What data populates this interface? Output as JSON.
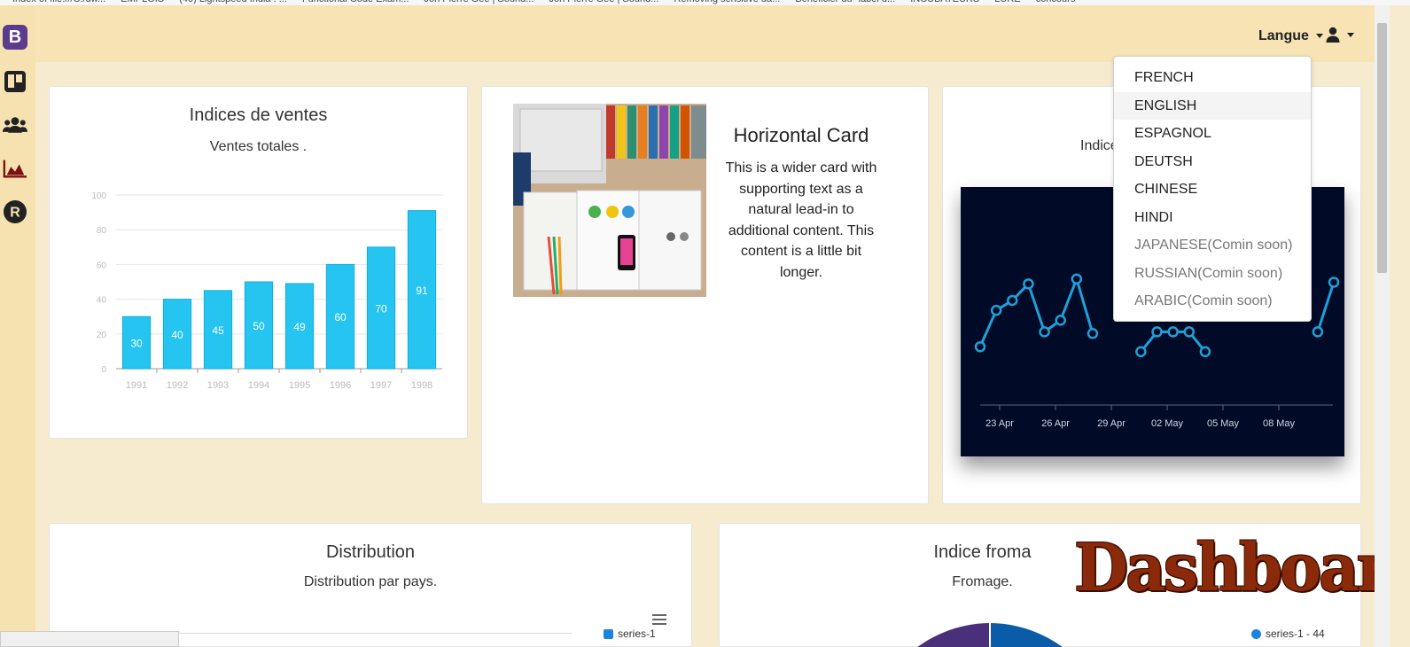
{
  "header": {
    "language_label": "Langue",
    "user_menu_icon": "user-icon"
  },
  "sidebar": {
    "brand": "B",
    "items": [
      {
        "icon": "trello-icon"
      },
      {
        "icon": "users-icon"
      },
      {
        "icon": "area-chart-icon"
      },
      {
        "icon": "r-circle-icon",
        "glyph": "R"
      }
    ]
  },
  "language_menu": {
    "items": [
      {
        "label": "FRENCH",
        "enabled": true
      },
      {
        "label": "ENGLISH",
        "enabled": true,
        "active": true
      },
      {
        "label": "ESPAGNOL",
        "enabled": true
      },
      {
        "label": "DEUTSH",
        "enabled": true
      },
      {
        "label": "CHINESE",
        "enabled": true
      },
      {
        "label": "HINDI",
        "enabled": true
      },
      {
        "label": "JAPANESE(Comin soon)",
        "enabled": false
      },
      {
        "label": "RUSSIAN(Comin soon)",
        "enabled": false
      },
      {
        "label": "ARABIC(Comin soon)",
        "enabled": false
      }
    ]
  },
  "sales_card": {
    "title": "Indices de ventes",
    "subtitle": "Ventes totales ."
  },
  "horizontal_card": {
    "title": "Horizontal Card",
    "text": "This is a wider card with supporting text as a natural lead-in to additional content. This content is a little bit longer."
  },
  "third_card": {
    "subtitle_partial": "Indice"
  },
  "distribution_card": {
    "title": "Distribution",
    "subtitle": "Distribution par pays.",
    "legend": "series-1"
  },
  "fromage_card": {
    "title_partial": "Indice froma",
    "subtitle_partial": "Fromage.",
    "legend": "series-1 - 44"
  },
  "overlay_logo": "Dashboard",
  "colors": {
    "topbar": "#f7e3b3",
    "sidebar": "#f5e2b0",
    "page_bg": "#f6ebcf",
    "bar": "#26c4f0",
    "dark_chart_bg": "#010a26",
    "line": "#1fa0d8"
  },
  "chart_data": [
    {
      "type": "bar",
      "categories": [
        "1991",
        "1992",
        "1993",
        "1994",
        "1995",
        "1996",
        "1997",
        "1998"
      ],
      "values": [
        30,
        40,
        45,
        50,
        49,
        60,
        70,
        91
      ],
      "ylim": [
        0,
        100
      ],
      "yticks": [
        0,
        20,
        40,
        60,
        80,
        100
      ],
      "data_labels": true,
      "grid": true
    },
    {
      "type": "line",
      "x_ticks": [
        "23 Apr",
        "26 Apr",
        "29 Apr",
        "02 May",
        "05 May",
        "08 May"
      ],
      "values": [
        9,
        31,
        37,
        47,
        18,
        25,
        50,
        17,
        null,
        null,
        6,
        18,
        18,
        18,
        6,
        null,
        null,
        null,
        null,
        28,
        null,
        18,
        48
      ],
      "partially_obscured": true,
      "grid": false
    }
  ]
}
